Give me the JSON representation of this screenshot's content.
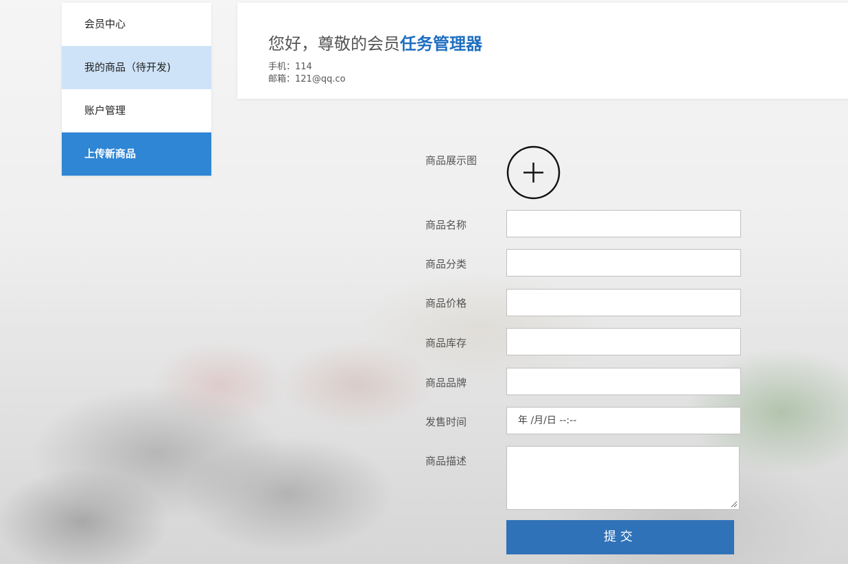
{
  "sidebar": {
    "items": [
      {
        "label": "会员中心"
      },
      {
        "label": "我的商品（待开发)"
      },
      {
        "label": "账户管理"
      },
      {
        "label": "上传新商品"
      }
    ]
  },
  "header": {
    "greeting_prefix": "您好，尊敬的会员",
    "member_name": "任务管理器",
    "phone": "手机：114",
    "email": "邮箱：121@qq.co"
  },
  "form": {
    "image_label": "商品展示图",
    "name_label": "商品名称",
    "category_label": "商品分类",
    "price_label": "商品价格",
    "stock_label": "商品库存",
    "brand_label": "商品品牌",
    "release_label": "发售时间",
    "release_placeholder": "年 /月/日 --:--",
    "description_label": "商品描述",
    "submit_label": "提交"
  },
  "colors": {
    "accent": "#2f86d4",
    "submit": "#2f72b8",
    "hover": "#cfe3f8",
    "name": "#1f6fc0"
  },
  "icons": {
    "upload": "plus-circle-icon",
    "textarea_resize": "resize-grip-icon"
  }
}
